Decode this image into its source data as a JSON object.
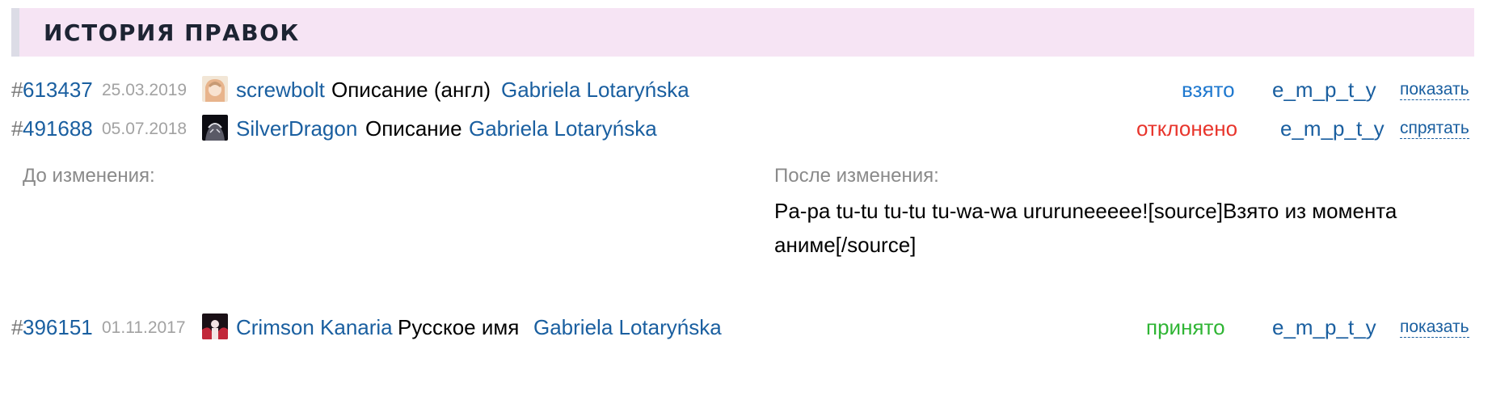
{
  "section": {
    "title": "ИСТОРИЯ ПРАВОК"
  },
  "hash_symbol": "#",
  "entries": [
    {
      "id": "613437",
      "date": "25.03.2019",
      "user": "screwbolt",
      "field": "Описание (англ)",
      "author": "Gabriela Lotaryńska",
      "status": "взято",
      "moderator": "e_m_p_t_y",
      "toggle": "показать",
      "avatar_colors": [
        "#f2e6d6",
        "#e8b48c",
        "#c79a74"
      ]
    },
    {
      "id": "491688",
      "date": "05.07.2018",
      "user": "SilverDragon",
      "field": "Описание",
      "author": "Gabriela Lotaryńska",
      "status": "отклонено",
      "moderator": "e_m_p_t_y",
      "toggle": "спрятать",
      "avatar_colors": [
        "#0c0c12",
        "#5a5a66",
        "#e0e0e6"
      ]
    },
    {
      "id": "396151",
      "date": "01.11.2017",
      "user": "Crimson Kanaria",
      "field": "Русское имя",
      "author": "Gabriela Lotaryńska",
      "status": "принято",
      "moderator": "e_m_p_t_y",
      "toggle": "показать",
      "avatar_colors": [
        "#1a1016",
        "#c2283a",
        "#f2e4e4"
      ]
    }
  ],
  "diff": {
    "before_label": "До изменения:",
    "after_label": "После изменения:",
    "after_text": "Pa-pa tu-tu tu-tu tu-wa-wa ururuneeeee![source]Взято из момента аниме[/source]"
  },
  "colors": {
    "link": "#1a5fa0",
    "status_taken": "#1e78cf",
    "status_rejected": "#e8352c",
    "status_accepted": "#2fb534",
    "header_bg": "#f6e4f4"
  },
  "icons": {
    "avatar": "user-avatar-icon"
  }
}
